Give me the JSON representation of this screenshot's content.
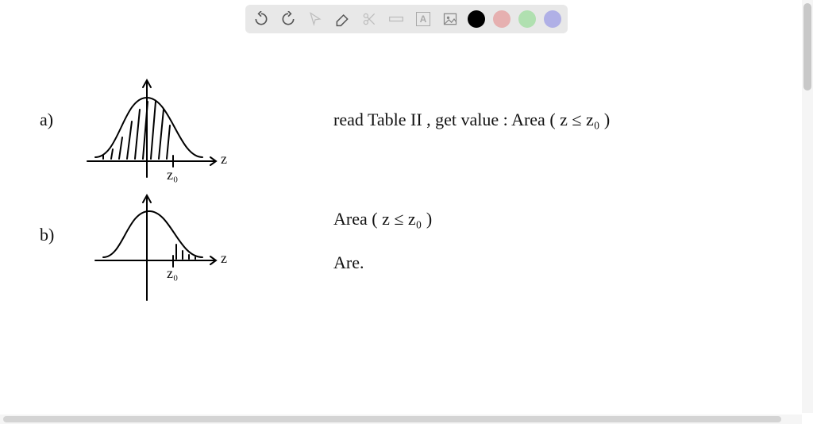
{
  "toolbar": {
    "undo": "undo",
    "redo": "redo",
    "pointer": "pointer",
    "eraser": "eraser",
    "scissors": "scissors",
    "ruler": "ruler",
    "text": "A",
    "image": "image",
    "colors": [
      "#000000",
      "#e6b0b0",
      "#b0e0b0",
      "#b0b0e6"
    ],
    "selected_color": "#000000"
  },
  "notes": {
    "partA": {
      "label": "a)",
      "axis_label": "z",
      "tick_label": "z₀",
      "text": "read Table II , get value : Area ( z ≤ z₀ )"
    },
    "partB": {
      "label": "b)",
      "axis_label": "z",
      "tick_label": "z₀",
      "line1": "Area ( z ≤ z₀ )",
      "line2": "Are."
    }
  }
}
